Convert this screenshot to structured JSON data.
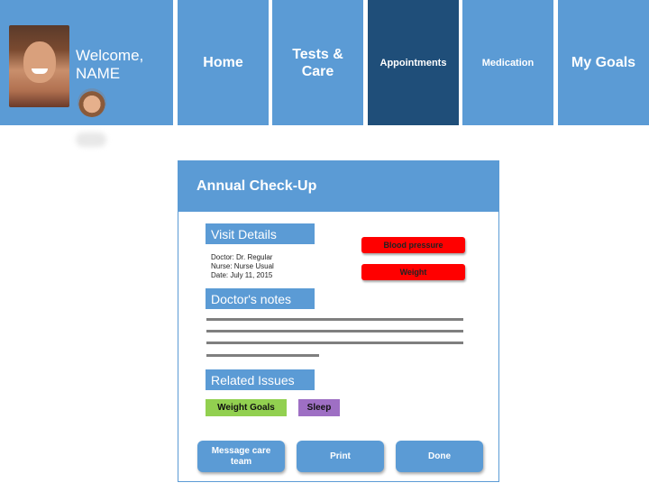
{
  "nav": {
    "welcome_line1": "Welcome,",
    "welcome_line2": "NAME",
    "home": "Home",
    "tests_line1": "Tests &",
    "tests_line2": "Care",
    "appointments": "Appointments",
    "medication": "Medication",
    "goals": "My Goals",
    "active_tab": "Appointments"
  },
  "card": {
    "title": "Annual Check-Up",
    "visit_label": "Visit Details",
    "doctor": "Doctor: Dr. Regular",
    "nurse": "Nurse: Nurse Usual",
    "date": "Date: July 11, 2015",
    "notes_label": "Doctor's notes",
    "related_label": "Related Issues",
    "flags": [
      "Blood pressure",
      "Weight"
    ],
    "tags": [
      "Weight Goals",
      "Sleep"
    ],
    "actions": {
      "message_line1": "Message care",
      "message_line2": "team",
      "print": "Print",
      "done": "Done"
    }
  },
  "colors": {
    "tile": "#5b9bd5",
    "active_tile": "#1f4e79",
    "alert": "#ff0000",
    "tag_goals": "#92d050",
    "tag_sleep": "#9e6fc4"
  }
}
